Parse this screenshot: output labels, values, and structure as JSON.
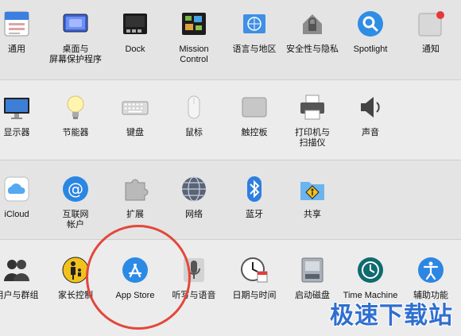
{
  "rows": [
    {
      "items": [
        {
          "name": "general",
          "label": "通用",
          "icon": "general-icon"
        },
        {
          "name": "desktop-screensaver",
          "label": "桌面与\n屏幕保护程序",
          "icon": "desktop-icon"
        },
        {
          "name": "dock",
          "label": "Dock",
          "icon": "dock-icon"
        },
        {
          "name": "mission-control",
          "label": "Mission\nControl",
          "icon": "mission-control-icon"
        },
        {
          "name": "language-region",
          "label": "语言与地区",
          "icon": "globe-flag-icon"
        },
        {
          "name": "security-privacy",
          "label": "安全性与隐私",
          "icon": "house-lock-icon"
        },
        {
          "name": "spotlight",
          "label": "Spotlight",
          "icon": "magnifier-icon"
        },
        {
          "name": "notifications",
          "label": "通知",
          "icon": "notification-icon"
        }
      ]
    },
    {
      "items": [
        {
          "name": "displays",
          "label": "显示器",
          "icon": "monitor-icon"
        },
        {
          "name": "energy-saver",
          "label": "节能器",
          "icon": "lightbulb-icon"
        },
        {
          "name": "keyboard",
          "label": "键盘",
          "icon": "keyboard-icon"
        },
        {
          "name": "mouse",
          "label": "鼠标",
          "icon": "mouse-icon"
        },
        {
          "name": "trackpad",
          "label": "触控板",
          "icon": "trackpad-icon"
        },
        {
          "name": "printers-scanners",
          "label": "打印机与\n扫描仪",
          "icon": "printer-icon"
        },
        {
          "name": "sound",
          "label": "声音",
          "icon": "speaker-icon"
        }
      ]
    },
    {
      "items": [
        {
          "name": "icloud",
          "label": "iCloud",
          "icon": "cloud-icon"
        },
        {
          "name": "internet-accounts",
          "label": "互联网\n帐户",
          "icon": "at-sign-icon"
        },
        {
          "name": "extensions",
          "label": "扩展",
          "icon": "puzzle-icon"
        },
        {
          "name": "network",
          "label": "网络",
          "icon": "network-globe-icon"
        },
        {
          "name": "bluetooth",
          "label": "蓝牙",
          "icon": "bluetooth-icon"
        },
        {
          "name": "sharing",
          "label": "共享",
          "icon": "sharing-folder-icon"
        }
      ]
    },
    {
      "items": [
        {
          "name": "users-groups",
          "label": "用户与群组",
          "icon": "users-icon"
        },
        {
          "name": "parental-controls",
          "label": "家长控制",
          "icon": "parental-icon"
        },
        {
          "name": "app-store",
          "label": "App Store",
          "icon": "app-store-icon"
        },
        {
          "name": "dictation-speech",
          "label": "听写与语音",
          "icon": "microphone-icon"
        },
        {
          "name": "date-time",
          "label": "日期与时间",
          "icon": "clock-calendar-icon"
        },
        {
          "name": "startup-disk",
          "label": "启动磁盘",
          "icon": "disk-icon"
        },
        {
          "name": "time-machine",
          "label": "Time Machine",
          "icon": "time-machine-icon"
        },
        {
          "name": "accessibility",
          "label": "辅助功能",
          "icon": "accessibility-icon"
        }
      ]
    }
  ],
  "watermark": "极速下载站",
  "colors": {
    "highlight_circle": "#e3473b",
    "watermark": "#2f6fd1"
  }
}
